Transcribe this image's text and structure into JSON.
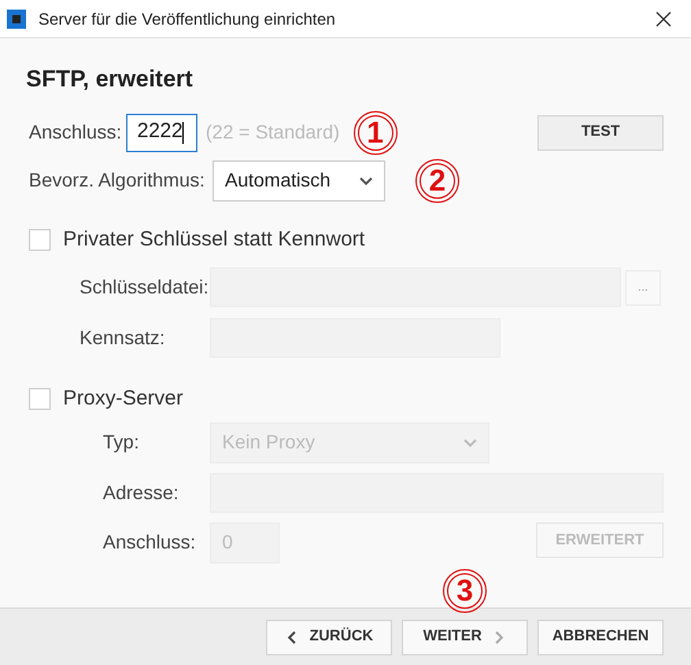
{
  "window": {
    "title": "Server für die Veröffentlichung einrichten"
  },
  "heading": "SFTP, erweitert",
  "port": {
    "label": "Anschluss:",
    "value": "2222",
    "hint": "(22 = Standard)",
    "annotation": "1"
  },
  "test_button": {
    "label": "TEST",
    "disabled": false
  },
  "algorithm": {
    "label": "Bevorz. Algorithmus:",
    "value": "Automatisch",
    "annotation": "2"
  },
  "private_key": {
    "label": "Privater Schlüssel statt Kennwort",
    "checked": false
  },
  "key_file": {
    "label": "Schlüsseldatei:",
    "browse": "...",
    "disabled": true
  },
  "passphrase": {
    "label": "Kennsatz:",
    "disabled": true
  },
  "proxy": {
    "label": "Proxy-Server",
    "checked": false
  },
  "proxy_type": {
    "label": "Typ:",
    "value": "Kein Proxy",
    "disabled": true
  },
  "proxy_address": {
    "label": "Adresse:",
    "disabled": true
  },
  "proxy_port": {
    "label": "Anschluss:",
    "value": "0",
    "disabled": true
  },
  "advanced_button": {
    "label": "ERWEITERT",
    "disabled": true
  },
  "footer_annotation": "3",
  "footer": [
    {
      "kind": "back",
      "label": "ZURÜCK"
    },
    {
      "kind": "next",
      "label": "WEITER"
    },
    {
      "kind": "cancel",
      "label": "ABBRECHEN"
    }
  ]
}
